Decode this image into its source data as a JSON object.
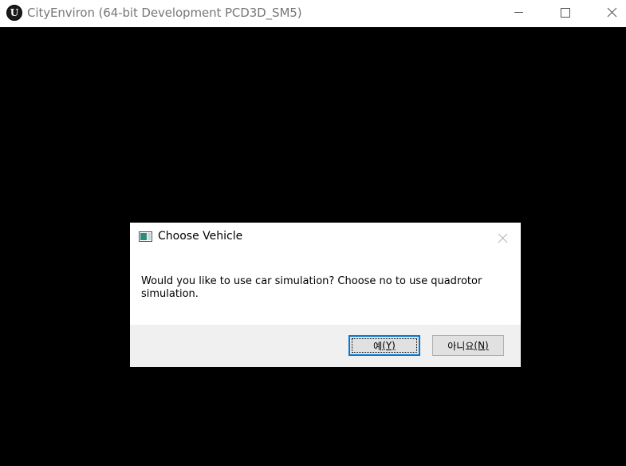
{
  "window": {
    "title": "CityEnviron (64-bit Development PCD3D_SM5)",
    "icon": "unreal-engine-logo",
    "controls": {
      "minimize_icon": "minimize-icon",
      "maximize_icon": "maximize-icon",
      "close_icon": "close-icon"
    }
  },
  "dialog": {
    "title": "Choose Vehicle",
    "message": "Would you like to use car simulation? Choose no to use quadrotor simulation.",
    "buttons": {
      "yes_label": "예",
      "yes_mnemonic": "(Y)",
      "no_label": "아니요",
      "no_mnemonic": "(N)"
    },
    "accent_color": "#0078d7"
  },
  "colors": {
    "background": "#000000",
    "titlebar": "#ffffff",
    "dialog_footer": "#f0f0f0"
  }
}
